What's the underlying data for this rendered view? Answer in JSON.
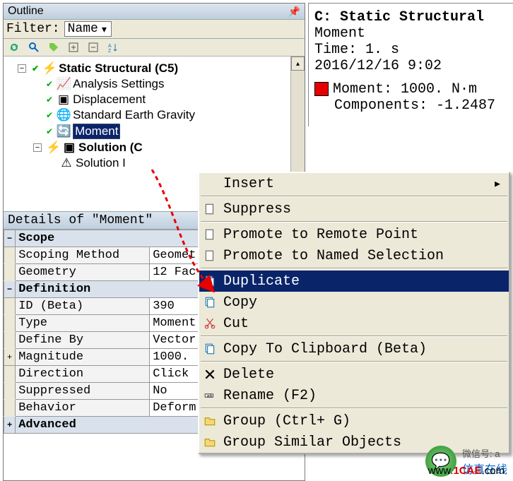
{
  "outline": {
    "title": "Outline",
    "filter_label": "Filter:",
    "filter_value": "Name",
    "tree": {
      "root": "Static Structural (C5)",
      "items": [
        "Analysis Settings",
        "Displacement",
        "Standard Earth Gravity",
        "Moment"
      ],
      "solution": "Solution (C",
      "solution_child": "Solution I"
    }
  },
  "details": {
    "title": "Details of \"Moment\"",
    "groups": [
      {
        "header": "Scope",
        "rows": [
          {
            "k": "Scoping Method",
            "v": "Geomet"
          },
          {
            "k": "Geometry",
            "v": "12 Fac"
          }
        ]
      },
      {
        "header": "Definition",
        "rows": [
          {
            "k": "ID (Beta)",
            "v": "390"
          },
          {
            "k": "Type",
            "v": "Moment"
          },
          {
            "k": "Define By",
            "v": "Vector"
          },
          {
            "k": "  Magnitude",
            "v": "1000. "
          },
          {
            "k": "Direction",
            "v": "Click "
          },
          {
            "k": "Suppressed",
            "v": "No"
          },
          {
            "k": "Behavior",
            "v": "Deform"
          }
        ]
      },
      {
        "header": "Advanced",
        "rows": []
      }
    ]
  },
  "info": {
    "title": "C: Static Structural",
    "lines": [
      "Moment",
      "Time: 1. s",
      "2016/12/16 9:02"
    ],
    "boxed": [
      "Moment: 1000. N·m",
      "Components: -1.2487"
    ]
  },
  "context_menu": {
    "items": [
      {
        "label": "Insert",
        "icon": "",
        "submenu": true
      },
      {
        "sep": true
      },
      {
        "label": "Suppress",
        "icon": "doc"
      },
      {
        "sep": true
      },
      {
        "label": "Promote to Remote Point",
        "icon": "doc"
      },
      {
        "label": "Promote to Named Selection",
        "icon": "doc"
      },
      {
        "sep": true
      },
      {
        "label": "Duplicate",
        "icon": "copy",
        "hl": true
      },
      {
        "label": "Copy",
        "icon": "copy"
      },
      {
        "label": "Cut",
        "icon": "cut"
      },
      {
        "sep": true
      },
      {
        "label": "Copy To Clipboard (Beta)",
        "icon": "copy"
      },
      {
        "sep": true
      },
      {
        "label": "Delete",
        "icon": "delete"
      },
      {
        "label": "Rename (F2)",
        "icon": "rename"
      },
      {
        "sep": true
      },
      {
        "label": "Group (Ctrl+ G)",
        "icon": "folder"
      },
      {
        "label": "Group Similar Objects",
        "icon": "folder"
      }
    ]
  },
  "watermark": {
    "wechat": "微信号: a",
    "brand_cn": "仿真在线",
    "brand_url_1": "www.",
    "brand_url_2": "1CAE",
    "brand_url_3": ".com"
  }
}
